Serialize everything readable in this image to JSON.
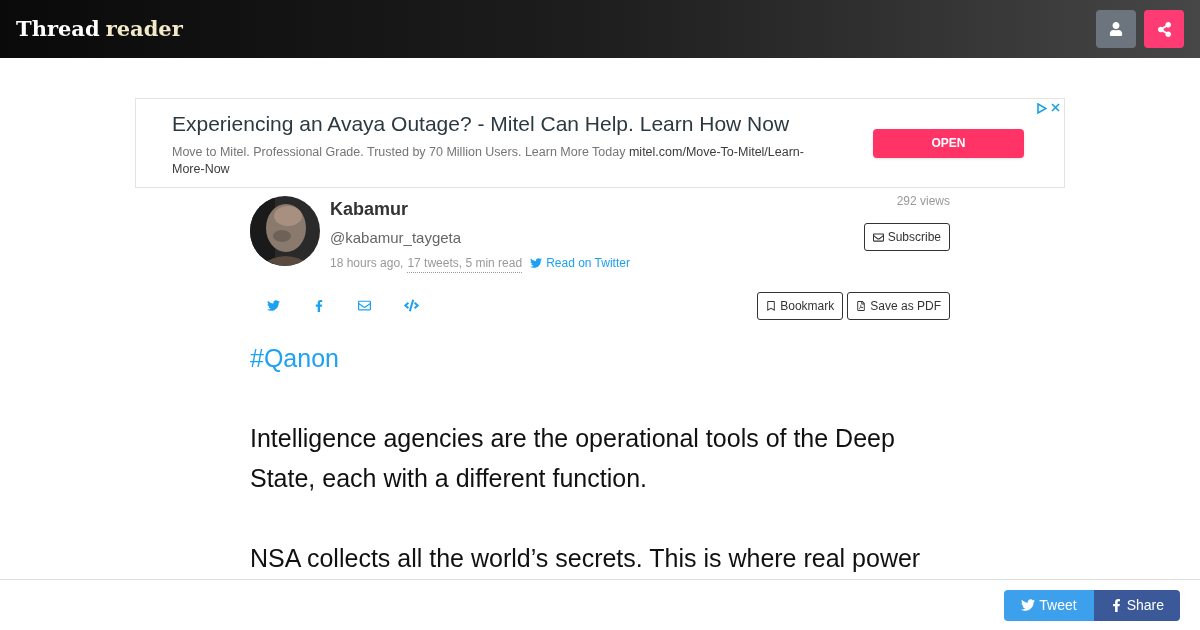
{
  "header": {
    "logo_first": "Thread",
    "logo_second": "reader"
  },
  "ad": {
    "title": "Experiencing an Avaya Outage? - Mitel Can Help. Learn How Now",
    "body": "Move to Mitel. Professional Grade. Trusted by 70 Million Users. Learn More Today",
    "url": "mitel.com/Move-To-Mitel/Learn-More-Now",
    "button": "OPEN"
  },
  "author": {
    "name": "Kabamur",
    "handle": "@kabamur_taygeta",
    "time": "18 hours ago,",
    "stats": "17 tweets, 5 min read",
    "read_link": "Read on Twitter",
    "views": "292 views",
    "subscribe": "Subscribe"
  },
  "actions": [
    "Bookmark",
    "Save as PDF"
  ],
  "thread": [
    "#Qanon",
    "Intelligence agencies are the operational tools of the Deep State, each with a different function.",
    "NSA collects all the world’s secrets. This is where real power"
  ],
  "footer": {
    "tweet": "Tweet",
    "share": "Share"
  }
}
